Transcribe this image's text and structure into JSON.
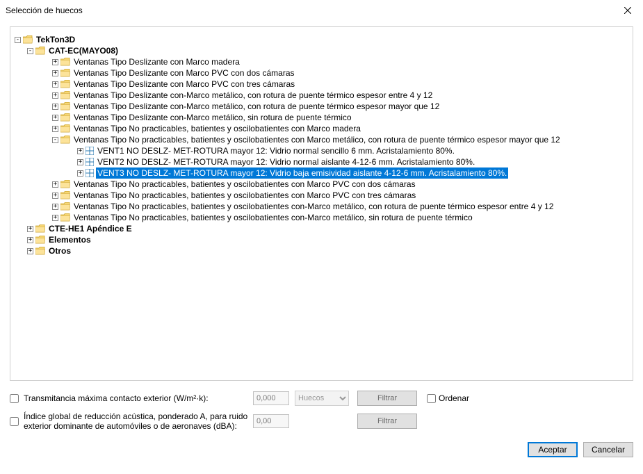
{
  "title": "Selección de huecos",
  "tree": {
    "root": {
      "label": "TekTon3D"
    },
    "catec": {
      "label": "CAT-EC(MAYO08)"
    },
    "catec_children": [
      "Ventanas Tipo Deslizante con Marco madera",
      "Ventanas Tipo Deslizante con Marco PVC con dos cámaras",
      "Ventanas Tipo Deslizante con Marco PVC con tres cámaras",
      "Ventanas Tipo Deslizante con-Marco metálico, con rotura de puente térmico espesor entre 4 y 12",
      "Ventanas Tipo Deslizante con-Marco metálico, con rotura de puente térmico espesor mayor que 12",
      "Ventanas Tipo Deslizante con-Marco metálico, sin rotura de puente térmico",
      "Ventanas Tipo No practicables, batientes y oscilobatientes con Marco madera"
    ],
    "expanded_node": "Ventanas Tipo No practicables, batientes y oscilobatientes con Marco metálico, con rotura de puente térmico espesor mayor que 12",
    "expanded_items": [
      "VENT1 NO DESLZ- MET-ROTURA mayor 12: Vidrio normal sencillo 6 mm.  Acristalamiento 80%.",
      "VENT2 NO DESLZ- MET-ROTURA mayor 12: Vidrio normal aislante 4-12-6 mm.  Acristalamiento 80%.",
      "VENT3 NO DESLZ- MET-ROTURA mayor 12: Vidrio baja emisividad aislante 4-12-6 mm.  Acristalamiento 80%."
    ],
    "catec_children_after": [
      "Ventanas Tipo No practicables, batientes y oscilobatientes con Marco PVC con dos cámaras",
      "Ventanas Tipo No practicables, batientes y oscilobatientes con Marco PVC con tres cámaras",
      "Ventanas Tipo No practicables, batientes y oscilobatientes con-Marco metálico, con rotura de puente térmico espesor entre 4 y 12",
      "Ventanas Tipo No practicables, batientes y oscilobatientes con-Marco metálico, sin rotura de puente térmico"
    ],
    "siblings": [
      "CTE-HE1 Apéndice E",
      "Elementos",
      "Otros"
    ]
  },
  "filters": {
    "transmitancia_label": "Transmitancia máxima contacto exterior (W/m²·k):",
    "transmitancia_value": "0,000",
    "indice_label": "Índice global de reducción acústica, ponderado A, para ruido exterior dominante de automóviles o de aeronaves (dBA):",
    "indice_value": "0,00",
    "combo_value": "Huecos",
    "filtrar": "Filtrar",
    "ordenar": "Ordenar"
  },
  "buttons": {
    "accept": "Aceptar",
    "cancel": "Cancelar"
  }
}
